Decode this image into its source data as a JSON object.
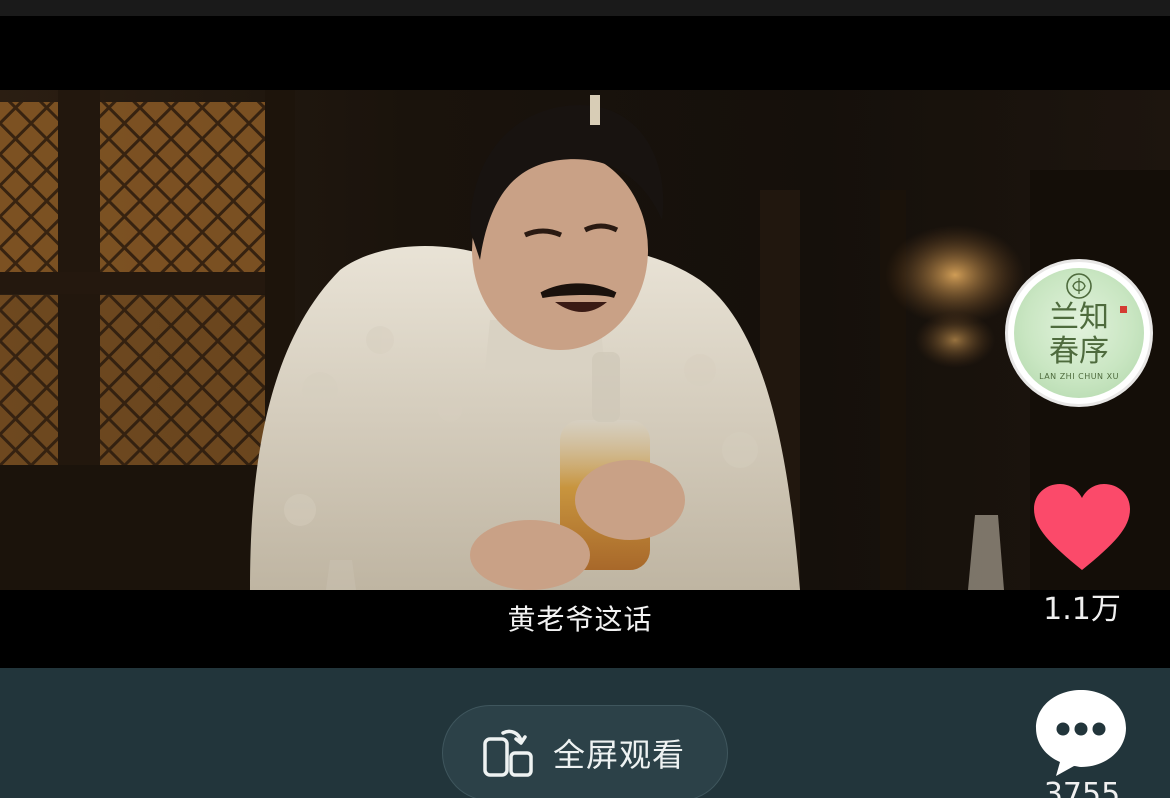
{
  "video": {
    "subtitle": "黄老爷这话"
  },
  "actions": {
    "fullscreen_label": "全屏观看",
    "like_count": "1.1万",
    "comment_count": "3755"
  },
  "author": {
    "logo_line1": "兰知",
    "logo_line2": "春序",
    "logo_sub": "LAN ZHI CHUN XU"
  },
  "colors": {
    "heart": "#fb4a6a",
    "bottom_panel": "#22353b"
  },
  "icons": {
    "fullscreen": "rotate-phone-icon",
    "like": "heart-icon",
    "comment": "speech-bubble-icon"
  }
}
